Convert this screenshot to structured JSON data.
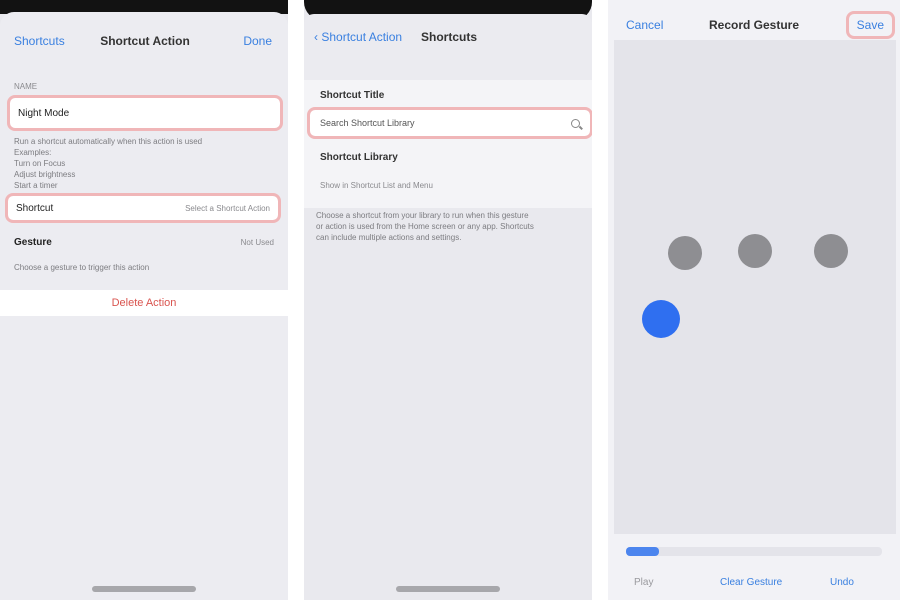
{
  "panel1": {
    "nav": {
      "left": "Shortcuts",
      "title": "Shortcut Action",
      "right": "Done"
    },
    "section_caption": "NAME",
    "name_field": {
      "value": "Night Mode"
    },
    "description_lines": [
      "Run a shortcut automatically when this action is used",
      "Examples:",
      "Turn on Focus",
      "Adjust brightness",
      "Start a timer"
    ],
    "action_row": {
      "label": "Shortcut",
      "value": "Select a Shortcut Action"
    },
    "gesture_row": {
      "label": "Gesture",
      "value": "Not Used"
    },
    "footer_note": "Choose a gesture to trigger this action",
    "delete_label": "Delete Action"
  },
  "panel2": {
    "nav": {
      "back": "Shortcut Action",
      "title": "Shortcuts"
    },
    "group_title": "Shortcut Title",
    "search_value": "Search Shortcut Library",
    "row_title": "Shortcut Library",
    "caption": "Show in Shortcut List and Menu",
    "description_lines": [
      "Choose a shortcut from your library to run when this gesture",
      "or action is used from the Home screen or any app. Shortcuts",
      "can include multiple actions and settings."
    ]
  },
  "panel3": {
    "nav": {
      "left": "Cancel",
      "title": "Record Gesture",
      "right": "Save"
    },
    "dots": [
      {
        "name": "touch-point-1",
        "color": "#8e8e92"
      },
      {
        "name": "touch-point-2",
        "color": "#8e8e92"
      },
      {
        "name": "touch-point-3",
        "color": "#8e8e92"
      },
      {
        "name": "active-touch-point",
        "color": "#2f6ff0"
      }
    ],
    "progress": 0.13,
    "bottom": {
      "left": "Play",
      "middle": "Clear Gesture",
      "right": "Undo"
    }
  }
}
